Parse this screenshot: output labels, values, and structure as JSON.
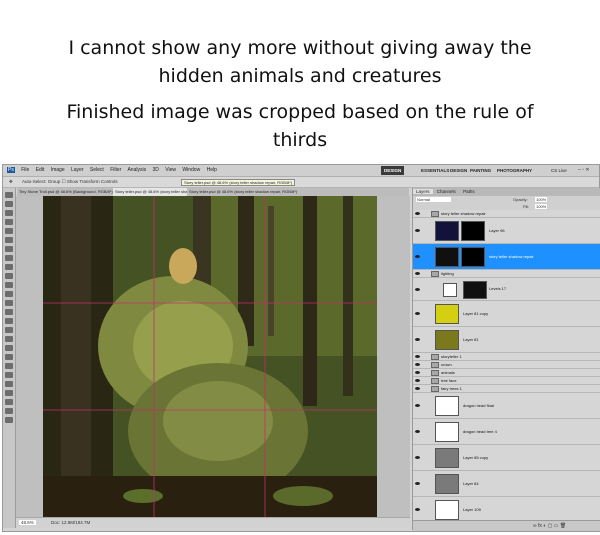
{
  "caption": {
    "line1": "I cannot show any more without giving away the hidden animals and creatures",
    "line2": "Finished image was cropped based on the  rule of thirds"
  },
  "app": {
    "menu": [
      "File",
      "Edit",
      "Image",
      "Layer",
      "Select",
      "Filter",
      "Analysis",
      "3D",
      "View",
      "Window",
      "Help"
    ],
    "workspaces": [
      "DESIGN",
      "ESSENTIALS",
      "DESIGN",
      "PAINTING",
      "PHOTOGRAPHY"
    ],
    "cs_live": "CS Live",
    "options_bar": "Auto-Select: Group  ☐ Show Transform Controls",
    "tabs": [
      "Tiny Stone Troll.psd @ 48.6% (Background, RGB/8*)",
      "Story teller.psd @ 48.6% (story teller shadow repair, RGB/8*)",
      "Story teller.psd @ 48.6% (story teller shadow repair, RGB/8*)"
    ],
    "tooltip": "Story teller.psd @ 48.6% (story teller shadow repair, RGB/8*)",
    "zoom": "48.6%",
    "doc_size": "Doc: 12.9M/194.7M"
  },
  "layers_panel": {
    "tabs": [
      "Layers",
      "Channels",
      "Paths"
    ],
    "blend": "Normal",
    "opacity_label": "Opacity:",
    "opacity": "100%",
    "fill_label": "Fill:",
    "fill": "100%",
    "rows": [
      {
        "name": "story teller shadow repair",
        "kind": "group"
      },
      {
        "name": "Layer 96",
        "kind": "layer",
        "thumb": "#12123a"
      },
      {
        "name": "story teller shadow repair",
        "kind": "layer",
        "thumb": "#101010",
        "selected": true
      },
      {
        "name": "lighting",
        "kind": "group"
      },
      {
        "name": "Levels 17",
        "kind": "adjust"
      },
      {
        "name": "Layer 81 copy",
        "kind": "layer",
        "thumb": "#d4cf10"
      },
      {
        "name": "Layer 81",
        "kind": "layer",
        "thumb": "#7a7a1c"
      },
      {
        "name": "storyteller 1",
        "kind": "group"
      },
      {
        "name": "crown",
        "kind": "group"
      },
      {
        "name": "animals",
        "kind": "group"
      },
      {
        "name": "tree face",
        "kind": "group"
      },
      {
        "name": "fairy trees 1",
        "kind": "group"
      },
      {
        "name": "dragon head final",
        "kind": "layer",
        "thumb": "#ffffff"
      },
      {
        "name": "dragon head tree 4",
        "kind": "layer",
        "thumb": "#ffffff"
      },
      {
        "name": "Layer 85 copy",
        "kind": "layer",
        "thumb": "#7a7a7a"
      },
      {
        "name": "Layer 84",
        "kind": "layer",
        "thumb": "#7a7a7a"
      },
      {
        "name": "Layer 109",
        "kind": "layer",
        "thumb": "#ffffff"
      }
    ]
  },
  "colors": {
    "selection": "#1e90ff",
    "guide": "#c0306a"
  },
  "chart_data": null
}
